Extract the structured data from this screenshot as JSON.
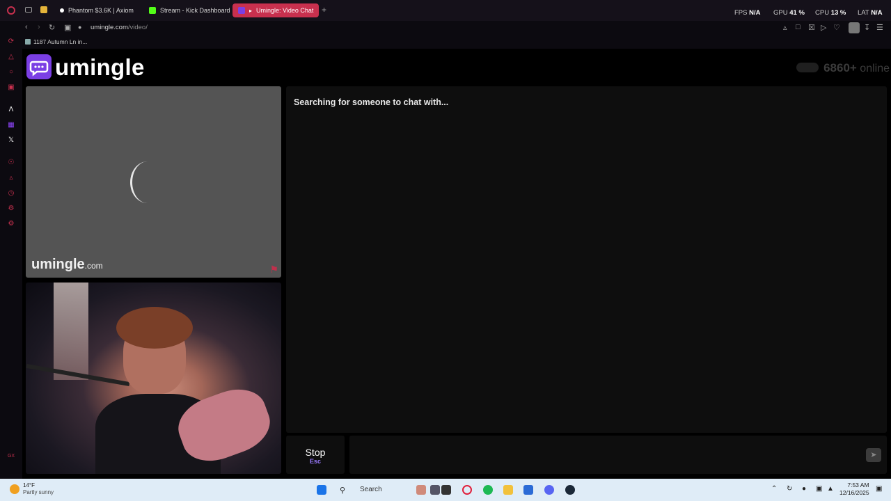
{
  "browser": {
    "tabs": [
      {
        "label": "Phantom $3.6K | Axiom",
        "active": false
      },
      {
        "label": "Stream - Kick Dashboard",
        "active": false
      },
      {
        "label": "Umingle: Video Chat",
        "active": true
      }
    ],
    "stats": {
      "fps_label": "FPS",
      "fps_value": "N/A",
      "gpu_label": "GPU",
      "gpu_value": "41 %",
      "cpu_label": "CPU",
      "cpu_value": "13 %",
      "lat_label": "LAT",
      "lat_value": "N/A"
    },
    "url_host": "umingle.com",
    "url_path": "/video/",
    "bookmark": "1187 Autumn Ln in...",
    "accent": "#c8304e"
  },
  "site": {
    "brand": "umingle",
    "online_count": "6860+",
    "online_label": "online",
    "watermark_main": "umingle",
    "watermark_suffix": ".com",
    "status_text": "Searching for someone to chat with...",
    "stop_label": "Stop",
    "stop_key": "Esc",
    "brand_color": "#7b3fe4"
  },
  "taskbar": {
    "weather_temp": "14°F",
    "weather_desc": "Partly sunny",
    "search_label": "Search",
    "time": "7:53 AM",
    "date": "12/16/2025"
  }
}
